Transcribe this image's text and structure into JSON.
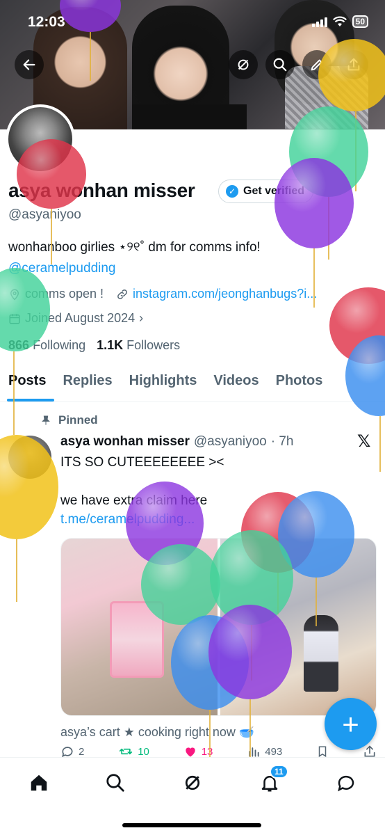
{
  "status_bar": {
    "time": "12:03",
    "battery": "50"
  },
  "profile": {
    "name": "asya wonhan misser",
    "handle": "@asyaniyoo",
    "get_verified_label": "Get verified",
    "bio": "wonhanboo girlies ⋆୨୧˚ dm for comms info!",
    "bio_link": "@ceramelpudding",
    "location": "comms open !",
    "website": "instagram.com/jeonghanbugs?i...",
    "joined": "Joined August 2024",
    "following_count": "866",
    "following_label": "Following",
    "followers_count": "1.1K",
    "followers_label": "Followers"
  },
  "tabs": [
    {
      "label": "Posts",
      "active": true
    },
    {
      "label": "Replies"
    },
    {
      "label": "Highlights"
    },
    {
      "label": "Videos"
    },
    {
      "label": "Photos"
    }
  ],
  "pinned_post": {
    "pinned_label": "Pinned",
    "author_name": "asya wonhan misser",
    "author_handle": "@asyaniyoo",
    "time": "· 7h",
    "text_line1": "ITS SO CUTEEEEEEEE ><",
    "text_line2": "we have extra claim here",
    "link": "t.me/ceramelpudding...",
    "next_text": "asya’s cart ★ cooking right now 🥣",
    "replies": "2",
    "reposts": "10",
    "likes": "13",
    "views": "493"
  },
  "nav": {
    "notification_badge": "11"
  },
  "colors": {
    "accent": "#1d9bf0",
    "like": "#f91880",
    "repost": "#00ba7c"
  }
}
